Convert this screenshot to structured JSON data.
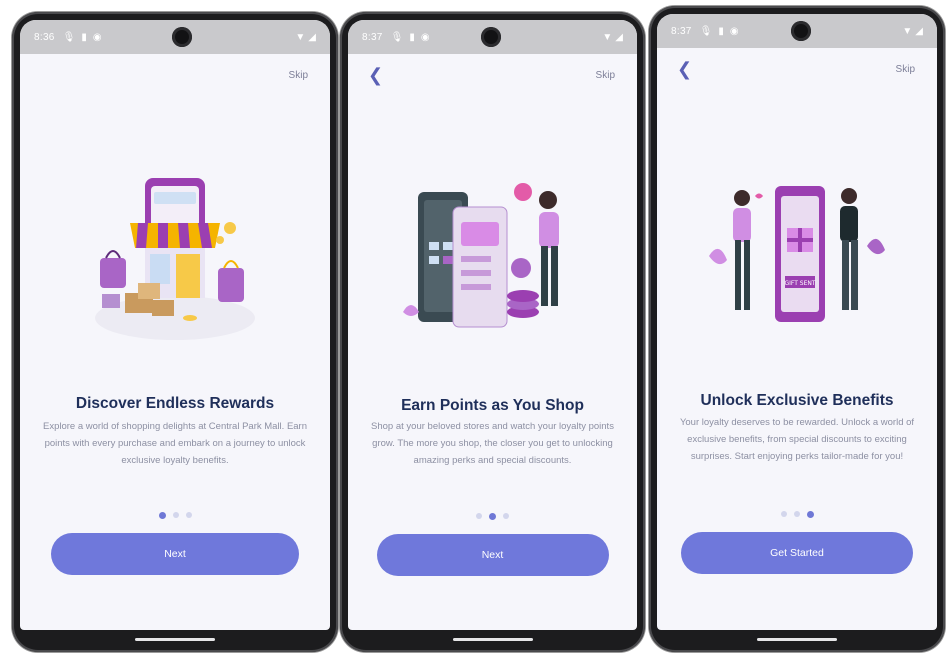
{
  "screens": [
    {
      "status": {
        "time": "8:36"
      },
      "skip": "Skip",
      "title": "Discover Endless Rewards",
      "description": "Explore a world of shopping delights at Central Park Mall. Earn points with every purchase and embark on a journey to unlock exclusive loyalty benefits.",
      "dots": {
        "count": 3,
        "active": 0
      },
      "button": "Next",
      "illustration_icon": "shop-storefront-illustration"
    },
    {
      "status": {
        "time": "8:37"
      },
      "skip": "Skip",
      "title": "Earn Points as You Shop",
      "description": "Shop at your beloved stores and watch your loyalty points grow. The more you shop, the closer you get to unlocking amazing perks and special discounts.",
      "dots": {
        "count": 3,
        "active": 1
      },
      "button": "Next",
      "illustration_icon": "phone-coins-shopper-illustration"
    },
    {
      "status": {
        "time": "8:37"
      },
      "skip": "Skip",
      "title": "Unlock Exclusive Benefits",
      "description": "Your loyalty deserves to be rewarded. Unlock a world of exclusive benefits, from special discounts to exciting surprises. Start enjoying perks tailor-made for you!",
      "dots": {
        "count": 3,
        "active": 2
      },
      "button": "Get Started",
      "illustration_icon": "gift-sent-phone-illustration",
      "gift_text": "GIFT SENT"
    }
  ],
  "colors": {
    "accent": "#6f78db",
    "title": "#1f2f5a",
    "body_text": "#8d90a3",
    "illustration_purple": "#9b3fb1"
  }
}
